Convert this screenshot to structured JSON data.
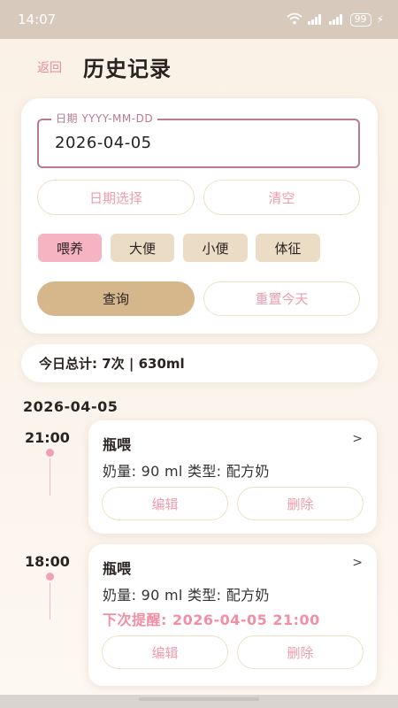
{
  "status": {
    "time": "14:07",
    "battery": "99"
  },
  "header": {
    "back_label": "返回",
    "title": "历史记录"
  },
  "filter": {
    "date_label": "日期 YYYY-MM-DD",
    "date_value": "2026-04-05",
    "pick_date_label": "日期选择",
    "clear_label": "清空",
    "categories": [
      {
        "label": "喂养",
        "active": true
      },
      {
        "label": "大便",
        "active": false
      },
      {
        "label": "小便",
        "active": false
      },
      {
        "label": "体征",
        "active": false
      }
    ],
    "query_label": "查询",
    "reset_label": "重置今天"
  },
  "summary": {
    "text": "今日总计: 7次 | 630ml"
  },
  "group": {
    "date": "2026-04-05"
  },
  "entries": [
    {
      "time": "21:00",
      "title": "瓶喂",
      "detail": "奶量: 90 ml  类型: 配方奶",
      "reminder": "",
      "edit_label": "编辑",
      "delete_label": "删除"
    },
    {
      "time": "18:00",
      "title": "瓶喂",
      "detail": "奶量: 90 ml  类型: 配方奶",
      "reminder": "下次提醒: 2026-04-05 21:00",
      "edit_label": "编辑",
      "delete_label": "删除"
    }
  ],
  "colors": {
    "accent_pink": "#f6b3c1",
    "query_brown": "#d6b78c",
    "chip_beige": "#ebdcc5",
    "reminder_pink": "#f28fa5"
  },
  "icons": {
    "chevron": "chevron-right-icon",
    "wifi": "wifi-icon",
    "signal": "signal-icon",
    "battery": "battery-icon"
  }
}
